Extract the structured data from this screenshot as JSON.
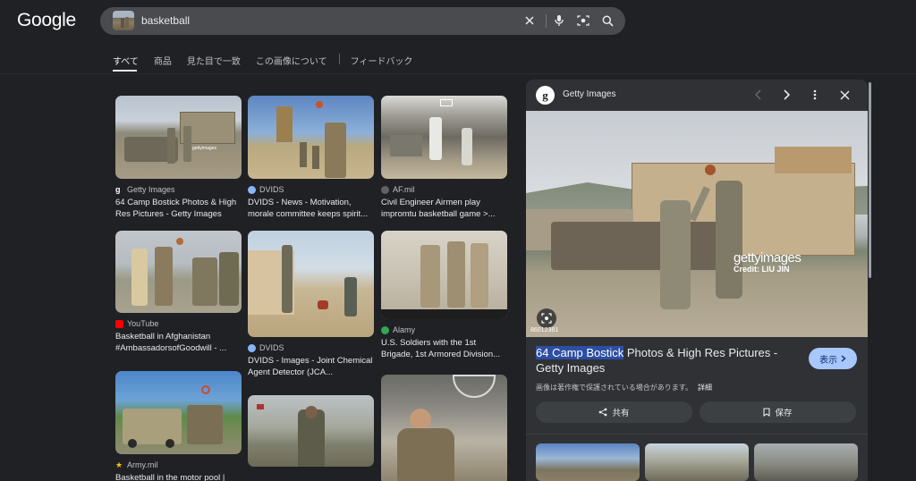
{
  "app": {
    "logo": "Google"
  },
  "search": {
    "query": "basketball",
    "clear_icon": "close-icon",
    "voice_icon": "mic-icon",
    "lens_icon": "camera-icon",
    "search_icon": "search-icon"
  },
  "tabs": [
    {
      "label": "すべて",
      "active": true
    },
    {
      "label": "商品",
      "active": false
    },
    {
      "label": "見た目で一致",
      "active": false
    },
    {
      "label": "この画像について",
      "active": false
    },
    {
      "label": "フィードバック",
      "active": false
    }
  ],
  "results": [
    {
      "source": "Getty Images",
      "title": "64 Camp Bostick Photos & High Res Pictures - Getty Images",
      "favicon_color": "#ffffff"
    },
    {
      "source": "YouTube",
      "title": "Basketball in Afghanistan #AmbassadorsofGoodwill - ...",
      "favicon_color": "#ff0000"
    },
    {
      "source": "Army.mil",
      "title": "Basketball in the motor pool |",
      "favicon_color": "#f4c20d"
    },
    {
      "source": "DVIDS",
      "title": "DVIDS - News - Motivation, morale committee keeps spirit...",
      "favicon_color": "#8ab4f8"
    },
    {
      "source": "DVIDS",
      "title": "DVIDS - Images - Joint Chemical Agent Detector (JCA...",
      "favicon_color": "#8ab4f8"
    },
    {
      "source": "AF.mil",
      "title": "Civil Engineer Airmen play impromtu basketball game >...",
      "favicon_color": "#5f6368"
    },
    {
      "source": "Alamy",
      "title": "U.S. Soldiers with the 1st Brigade, 1st Armored Division...",
      "favicon_color": "#34a853"
    }
  ],
  "panel": {
    "source": "Getty Images",
    "prev_icon": "chevron-left-icon",
    "next_icon": "chevron-right-icon",
    "more_icon": "more-vert-icon",
    "close_icon": "close-icon",
    "watermark": "gettyimages",
    "credit": "Credit: LIU JIN",
    "image_code": "86012381",
    "title_highlight": "64 Camp Bostick",
    "title_rest": " Photos & High Res Pictures - Getty Images",
    "view_label": "表示",
    "copyright_note": "画像は著作権で保護されている場合があります。",
    "details_link": "詳細",
    "share_label": "共有",
    "save_label": "保存"
  }
}
